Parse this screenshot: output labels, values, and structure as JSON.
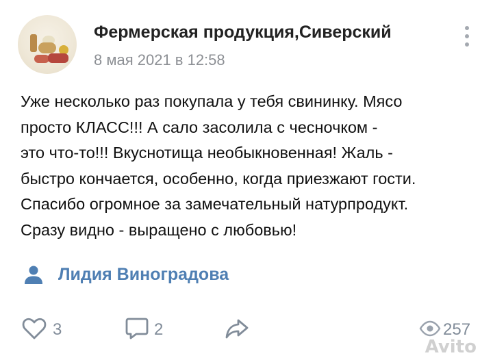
{
  "post": {
    "group_name": "Фермерская продукция,Сиверский",
    "date": "8 мая 2021 в 12:58",
    "text_lines": [
      "Уже несколько раз покупала у тебя свининку. Мясо",
      "просто КЛАСС!!! А сало засолила с чесночком -",
      "это что-то!!! Вкуснотища необыкновенная! Жаль -",
      "быстро кончается, особенно, когда приезжают гости.",
      "Спасибо огромное за замечательный натурпродукт.",
      "Сразу видно - выращено с любовью!"
    ],
    "author_name": "Лидия Виноградова"
  },
  "actions": {
    "likes": "3",
    "comments": "2",
    "views": "257"
  },
  "icons": {
    "more": "more-vertical-icon",
    "user": "user-icon",
    "like": "heart-icon",
    "comment": "comment-icon",
    "share": "share-arrow-icon",
    "views": "eye-icon"
  },
  "watermark": "Avito",
  "colors": {
    "author_link": "#4f7fb3",
    "muted": "#818c99",
    "date": "#8c8f94"
  }
}
